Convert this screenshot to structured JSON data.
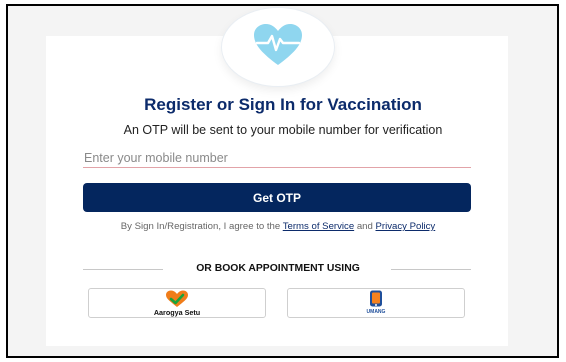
{
  "page": {
    "title": "Register or Sign In for Vaccination",
    "subtitle": "An OTP will be sent to your mobile number for verification"
  },
  "form": {
    "mobile_placeholder": "Enter your mobile number",
    "mobile_value": "",
    "submit_label": "Get OTP"
  },
  "terms": {
    "prefix": "By Sign In/Registration, I agree to the ",
    "terms_link": "Terms of Service",
    "middle": " and ",
    "privacy_link": "Privacy Policy"
  },
  "alternatives": {
    "heading": "OR BOOK APPOINTMENT USING",
    "apps": [
      {
        "label": "Aarogya Setu",
        "icon": "heart-check-icon"
      },
      {
        "label": "UMANG",
        "icon": "umang-app-icon"
      }
    ]
  },
  "colors": {
    "primary": "#04265e",
    "title": "#0c2b6b",
    "input_underline": "#e2a3a8",
    "heart": "#8fd6ef",
    "aarogya_orange": "#f07d1a",
    "aarogya_green": "#18a33a"
  }
}
